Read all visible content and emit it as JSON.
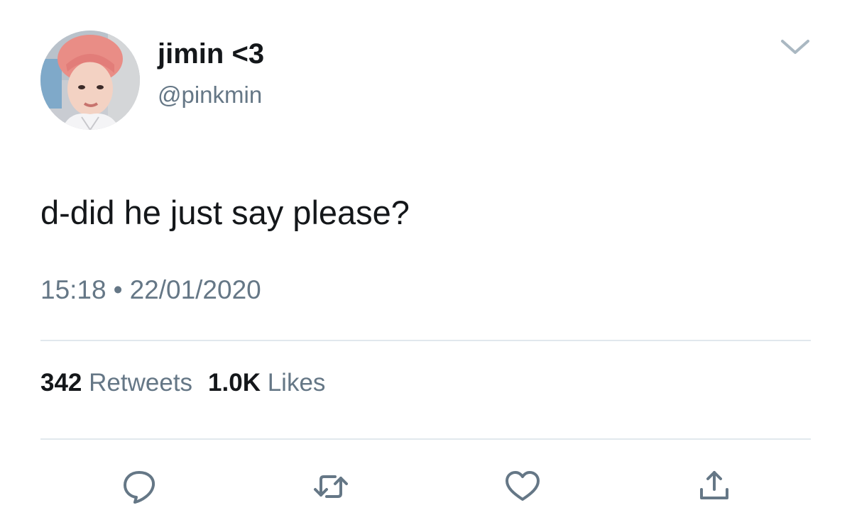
{
  "tweet": {
    "author": {
      "display_name": "jimin <3",
      "handle": "@pinkmin",
      "avatar": "avatar-photo"
    },
    "text": "d-did he just say please?",
    "time": "15:18",
    "separator": "•",
    "date": "22/01/2020",
    "stats": {
      "retweets_count": "342",
      "retweets_label": "Retweets",
      "likes_count": "1.0K",
      "likes_label": "Likes"
    },
    "actions": [
      {
        "icon": "reply-icon"
      },
      {
        "icon": "retweet-icon"
      },
      {
        "icon": "like-icon"
      },
      {
        "icon": "share-icon"
      }
    ],
    "menu_icon": "chevron-down-icon"
  },
  "colors": {
    "primary_text": "#14171a",
    "secondary_text": "#657786",
    "divider": "#e1e8ed",
    "icon": "#657786"
  }
}
